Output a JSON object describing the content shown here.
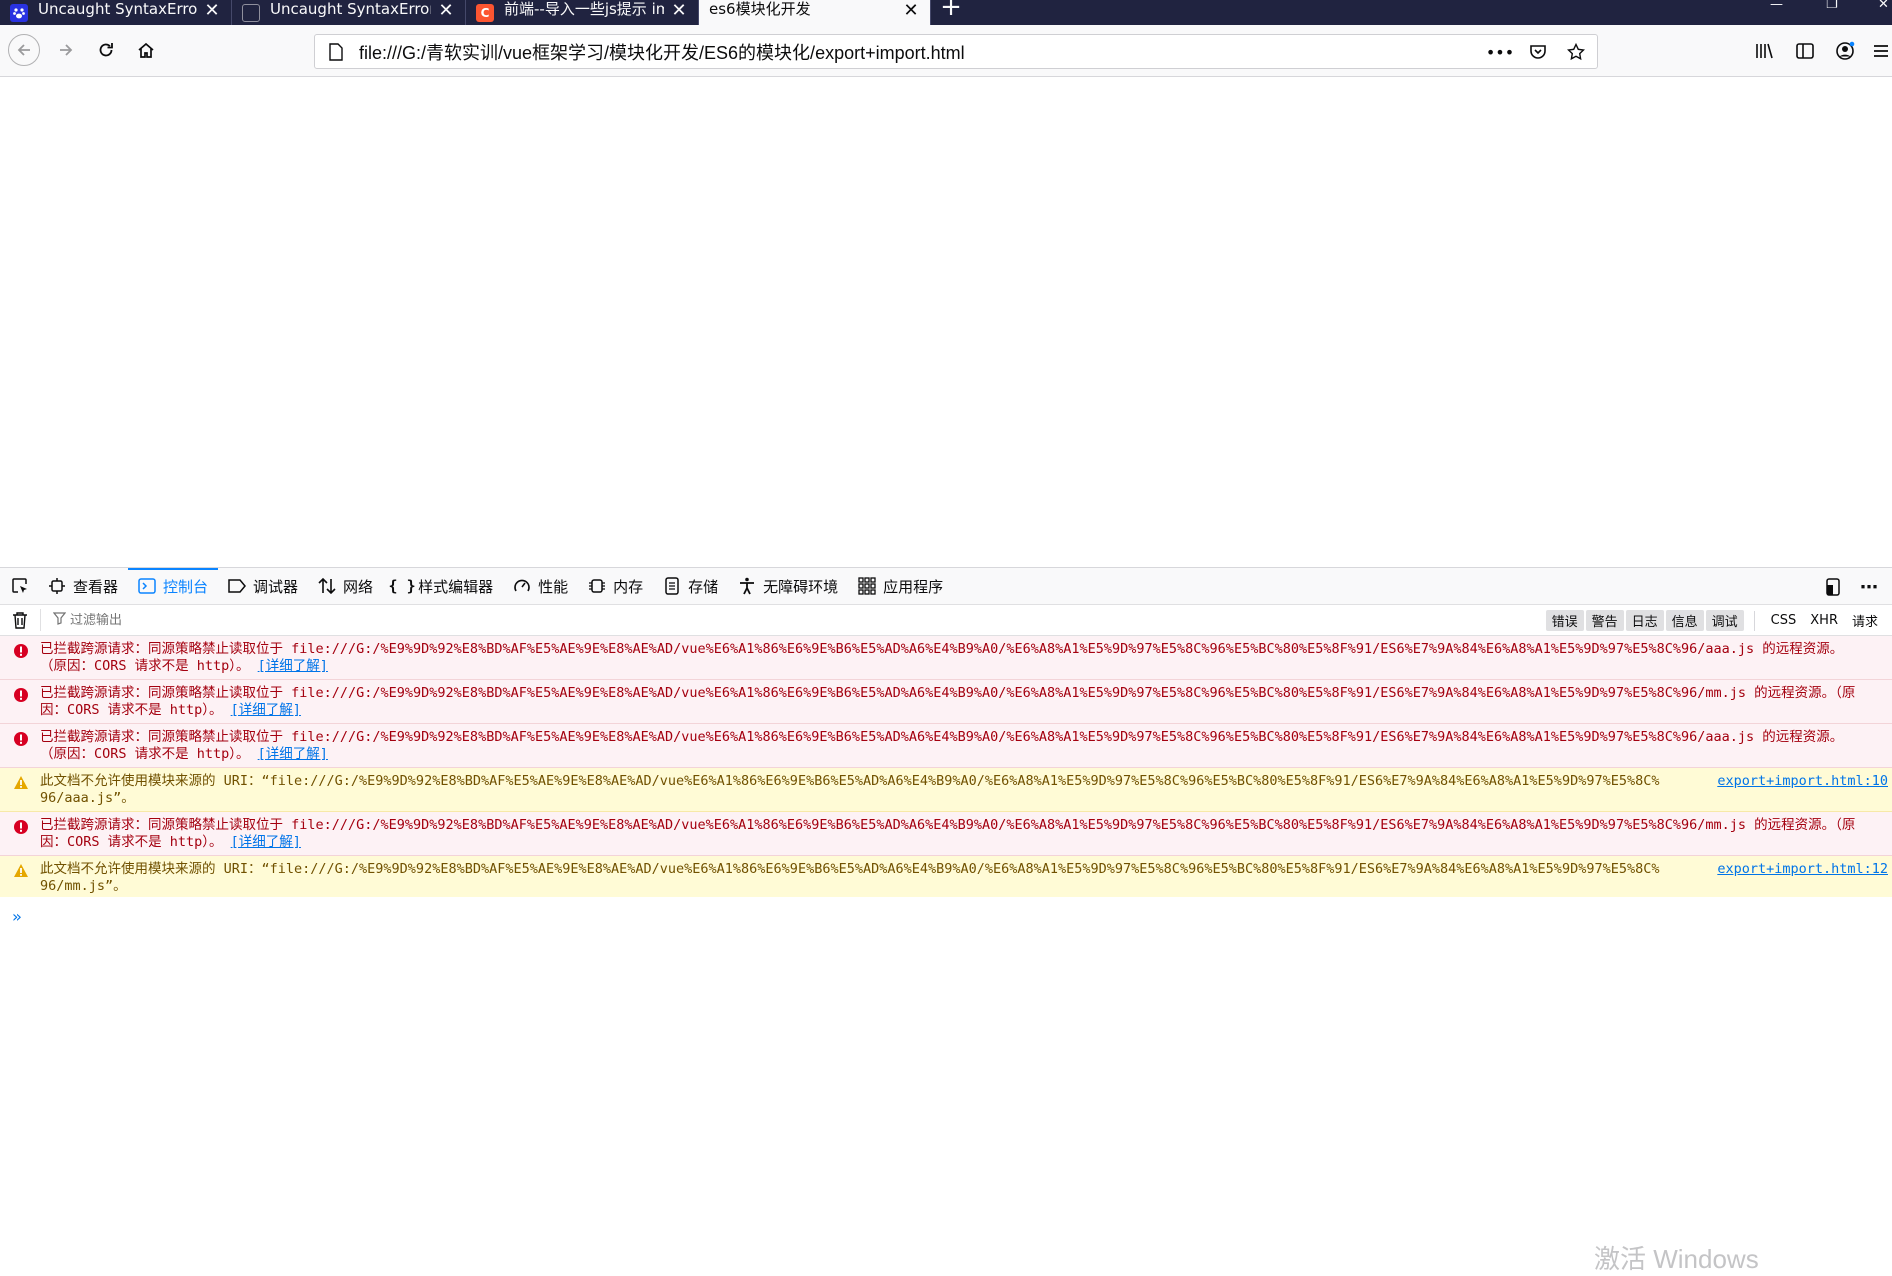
{
  "tabs": [
    {
      "title": "Uncaught SyntaxError: Unexp",
      "favicon": "baidu-paw-icon"
    },
    {
      "title": "Uncaught SyntaxError: Unexp",
      "favicon": "blank-page-icon"
    },
    {
      "title": "前端--导入一些js提示 import c",
      "favicon": "csdn-c-icon"
    },
    {
      "title": "es6模块化开发",
      "favicon": "none",
      "active": true
    }
  ],
  "address_bar": {
    "url": "file:///G:/青软实训/vue框架学习/模块化开发/ES6的模块化/export+import.html"
  },
  "devtools": {
    "tabs": [
      {
        "label": "查看器",
        "icon": "inspector-icon"
      },
      {
        "label": "控制台",
        "icon": "console-icon",
        "active": true
      },
      {
        "label": "调试器",
        "icon": "debugger-icon"
      },
      {
        "label": "网络",
        "icon": "network-icon"
      },
      {
        "label": "样式编辑器",
        "icon": "style-editor-icon"
      },
      {
        "label": "性能",
        "icon": "performance-icon"
      },
      {
        "label": "内存",
        "icon": "memory-icon"
      },
      {
        "label": "存储",
        "icon": "storage-icon"
      },
      {
        "label": "无障碍环境",
        "icon": "accessibility-icon"
      },
      {
        "label": "应用程序",
        "icon": "application-icon"
      }
    ],
    "filter": {
      "placeholder": "过滤输出",
      "levels": [
        "错误",
        "警告",
        "日志",
        "信息",
        "调试"
      ],
      "categories": [
        "CSS",
        "XHR",
        "请求"
      ]
    },
    "messages": [
      {
        "type": "error",
        "text": "已拦截跨源请求：同源策略禁止读取位于 file:///G:/%E9%9D%92%E8%BD%AF%E5%AE%9E%E8%AE%AD/vue%E6%A1%86%E6%9E%B6%E5%AD%A6%E4%B9%A0/%E6%A8%A1%E5%9D%97%E5%8C%96%E5%BC%80%E5%8F%91/ES6%E7%9A%84%E6%A8%A1%E5%9D%97%E5%8C%96/aaa.js 的远程资源。（原因：CORS 请求不是 http）。",
        "link": "[详细了解]"
      },
      {
        "type": "error",
        "text": "已拦截跨源请求：同源策略禁止读取位于 file:///G:/%E9%9D%92%E8%BD%AF%E5%AE%9E%E8%AE%AD/vue%E6%A1%86%E6%9E%B6%E5%AD%A6%E4%B9%A0/%E6%A8%A1%E5%9D%97%E5%8C%96%E5%BC%80%E5%8F%91/ES6%E7%9A%84%E6%A8%A1%E5%9D%97%E5%8C%96/mm.js 的远程资源。（原因：CORS 请求不是 http）。",
        "link": "[详细了解]"
      },
      {
        "type": "error",
        "text": "已拦截跨源请求：同源策略禁止读取位于 file:///G:/%E9%9D%92%E8%BD%AF%E5%AE%9E%E8%AE%AD/vue%E6%A1%86%E6%9E%B6%E5%AD%A6%E4%B9%A0/%E6%A8%A1%E5%9D%97%E5%8C%96%E5%BC%80%E5%8F%91/ES6%E7%9A%84%E6%A8%A1%E5%9D%97%E5%8C%96/aaa.js 的远程资源。（原因：CORS 请求不是 http）。",
        "link": "[详细了解]"
      },
      {
        "type": "warn",
        "text": "此文档不允许使用模块来源的 URI：“file:///G:/%E9%9D%92%E8%BD%AF%E5%AE%9E%E8%AE%AD/vue%E6%A1%86%E6%9E%B6%E5%AD%A6%E4%B9%A0/%E6%A8%A1%E5%9D%97%E5%8C%96%E5%BC%80%E5%8F%91/ES6%E7%9A%84%E6%A8%A1%E5%9D%97%E5%8C%96/aaa.js”。",
        "source": "export+import.html:10"
      },
      {
        "type": "error",
        "text": "已拦截跨源请求：同源策略禁止读取位于 file:///G:/%E9%9D%92%E8%BD%AF%E5%AE%9E%E8%AE%AD/vue%E6%A1%86%E6%9E%B6%E5%AD%A6%E4%B9%A0/%E6%A8%A1%E5%9D%97%E5%8C%96%E5%BC%80%E5%8F%91/ES6%E7%9A%84%E6%A8%A1%E5%9D%97%E5%8C%96/mm.js 的远程资源。（原因：CORS 请求不是 http）。",
        "link": "[详细了解]"
      },
      {
        "type": "warn",
        "text": "此文档不允许使用模块来源的 URI：“file:///G:/%E9%9D%92%E8%BD%AF%E5%AE%9E%E8%AE%AD/vue%E6%A1%86%E6%9E%B6%E5%AD%A6%E4%B9%A0/%E6%A8%A1%E5%9D%97%E5%8C%96%E5%BC%80%E5%8F%91/ES6%E7%9A%84%E6%A8%A1%E5%9D%97%E5%8C%96/mm.js”。",
        "source": "export+import.html:12"
      }
    ],
    "prompt_symbol": "»"
  },
  "watermark": "激活 Windows",
  "colors": {
    "tabstrip": "#202340",
    "accent": "#0a84ff",
    "error_text": "#a4000f",
    "error_bg": "#fdf2f5",
    "warn_text": "#715100",
    "warn_bg": "#fffbd6"
  }
}
